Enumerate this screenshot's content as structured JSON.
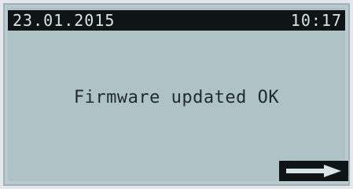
{
  "status_bar": {
    "date": "23.01.2015",
    "time": "10:17"
  },
  "message": {
    "text": "Firmware updated OK"
  },
  "softkey_right": {
    "icon": "arrow-right-icon"
  },
  "colors": {
    "screen_background": "#afc3c7",
    "bar_background": "#0f1416",
    "bar_text": "#d9e4e6",
    "message_text": "#1f2a2c"
  }
}
